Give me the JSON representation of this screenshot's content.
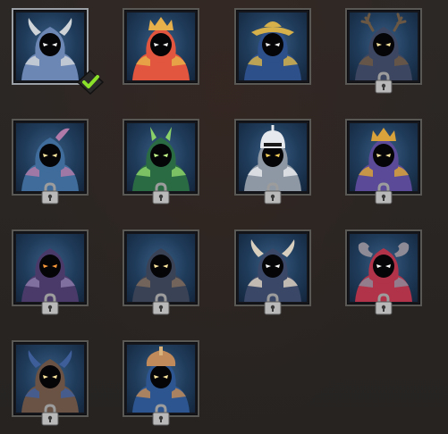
{
  "screen": "character-select",
  "colors": {
    "background": "#2a2624",
    "frame": "#5a5855",
    "portrait_bg": "#2a4a6e",
    "lock": "#b9b9b9",
    "check": "#7ed321"
  },
  "characters": [
    {
      "id": "viking",
      "locked": false,
      "selected": true,
      "cloak": "#6d87b5",
      "accent": "#cfd4d8",
      "eyes": "#ffffff",
      "headgear": "horns"
    },
    {
      "id": "royal",
      "locked": false,
      "selected": false,
      "cloak": "#e2553e",
      "accent": "#e8b04a",
      "eyes": "#ffffff",
      "headgear": "crown"
    },
    {
      "id": "pirate",
      "locked": false,
      "selected": false,
      "cloak": "#2d4f8a",
      "accent": "#d6b04a",
      "eyes": "#ffffff",
      "headgear": "hat"
    },
    {
      "id": "antlered",
      "locked": true,
      "selected": false,
      "cloak": "#3d4660",
      "accent": "#6b5844",
      "eyes": "#ffe7a0",
      "headgear": "antlers"
    },
    {
      "id": "feathered",
      "locked": true,
      "selected": false,
      "cloak": "#3f6c9a",
      "accent": "#b17aa8",
      "eyes": "#ffe7a0",
      "headgear": "feather"
    },
    {
      "id": "forest",
      "locked": true,
      "selected": false,
      "cloak": "#2b6b44",
      "accent": "#8bd16a",
      "eyes": "#c6ff8a",
      "headgear": "ears"
    },
    {
      "id": "knight",
      "locked": true,
      "selected": false,
      "cloak": "#8e98a4",
      "accent": "#e6e9ed",
      "eyes": "#ffd25a",
      "headgear": "helm"
    },
    {
      "id": "sorcerer",
      "locked": true,
      "selected": false,
      "cloak": "#5a4a98",
      "accent": "#d9a23a",
      "eyes": "#ffe7a0",
      "headgear": "crown"
    },
    {
      "id": "purple-hood",
      "locked": true,
      "selected": false,
      "cloak": "#4a3a6a",
      "accent": "#8a7aa8",
      "eyes": "#ff9a3a",
      "headgear": "hood"
    },
    {
      "id": "rogue",
      "locked": true,
      "selected": false,
      "cloak": "#3a4256",
      "accent": "#7c6a5a",
      "eyes": "#ffe7a0",
      "headgear": "hood"
    },
    {
      "id": "skull-shaman",
      "locked": true,
      "selected": false,
      "cloak": "#3b4766",
      "accent": "#d8cfbf",
      "eyes": "#ffffff",
      "headgear": "horns"
    },
    {
      "id": "red-ram",
      "locked": true,
      "selected": false,
      "cloak": "#b0334a",
      "accent": "#8e8a96",
      "eyes": "#ffffff",
      "headgear": "ram"
    },
    {
      "id": "horned-warrior",
      "locked": true,
      "selected": false,
      "cloak": "#6a5244",
      "accent": "#3e5e9a",
      "eyes": "#ffe7a0",
      "headgear": "horns"
    },
    {
      "id": "gladiator",
      "locked": true,
      "selected": false,
      "cloak": "#2d5690",
      "accent": "#c08a5a",
      "eyes": "#ffe7a0",
      "headgear": "crest"
    }
  ]
}
